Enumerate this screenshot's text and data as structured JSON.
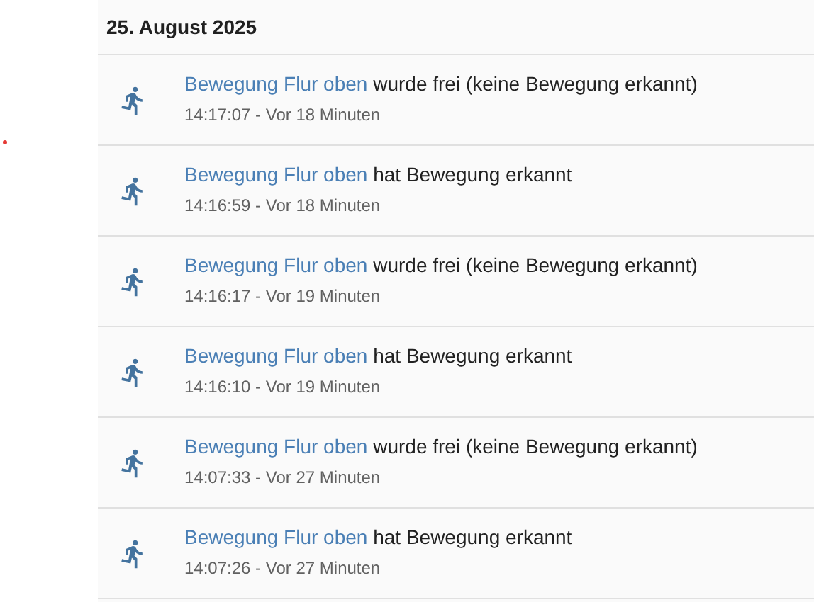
{
  "date_header": "25. August 2025",
  "entries": [
    {
      "entity": "Bewegung Flur oben",
      "message": "wurde frei (keine Bewegung erkannt)",
      "time": "14:17:07 - Vor 18 Minuten"
    },
    {
      "entity": "Bewegung Flur oben",
      "message": "hat Bewegung erkannt",
      "time": "14:16:59 - Vor 18 Minuten"
    },
    {
      "entity": "Bewegung Flur oben",
      "message": "wurde frei (keine Bewegung erkannt)",
      "time": "14:16:17 - Vor 19 Minuten"
    },
    {
      "entity": "Bewegung Flur oben",
      "message": "hat Bewegung erkannt",
      "time": "14:16:10 - Vor 19 Minuten"
    },
    {
      "entity": "Bewegung Flur oben",
      "message": "wurde frei (keine Bewegung erkannt)",
      "time": "14:07:33 - Vor 27 Minuten"
    },
    {
      "entity": "Bewegung Flur oben",
      "message": "hat Bewegung erkannt",
      "time": "14:07:26 - Vor 27 Minuten"
    }
  ]
}
